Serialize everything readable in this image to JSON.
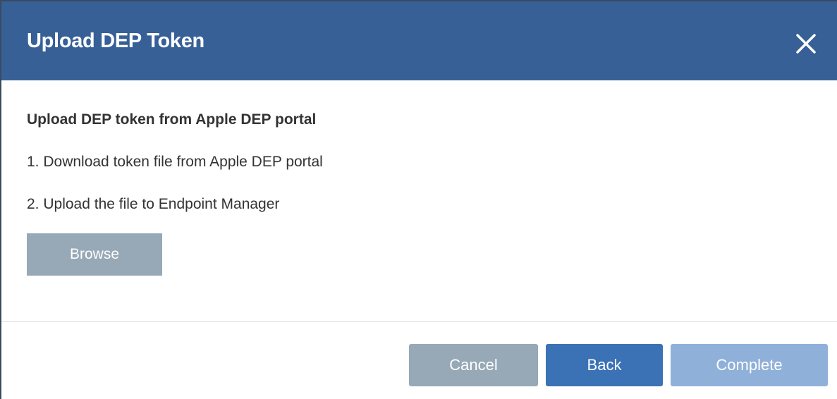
{
  "dialog": {
    "title": "Upload DEP Token",
    "close_icon": "close-icon"
  },
  "content": {
    "subtitle": "Upload DEP token from Apple DEP portal",
    "steps": [
      "1. Download token file from Apple DEP portal",
      "2. Upload the file to Endpoint Manager"
    ],
    "browse_label": "Browse"
  },
  "footer": {
    "cancel_label": "Cancel",
    "back_label": "Back",
    "complete_label": "Complete"
  },
  "colors": {
    "header": "#376097",
    "primary_button": "#3b72b6",
    "disabled_button": "#8fb0d9",
    "secondary_button": "#97a8b6"
  }
}
